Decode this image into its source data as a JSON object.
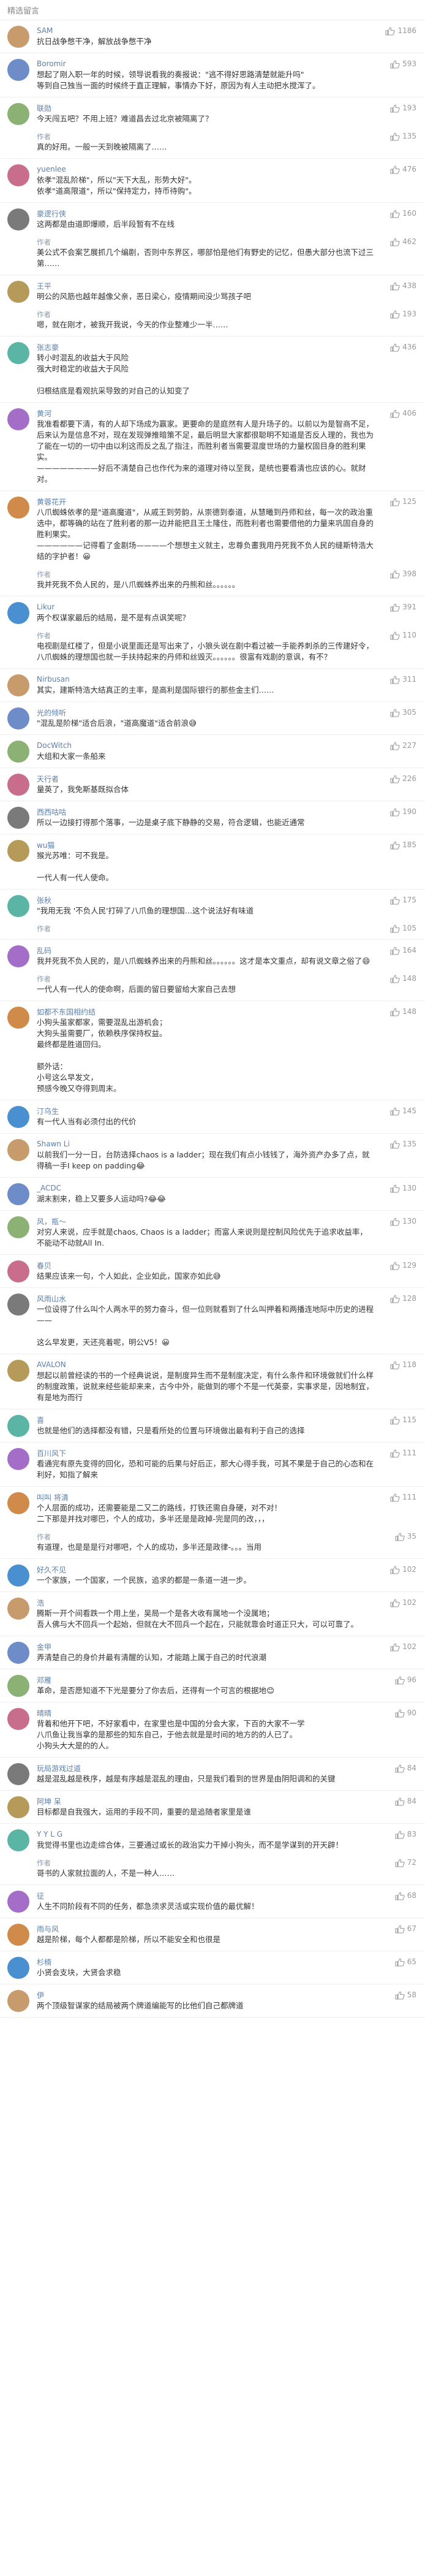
{
  "header": {
    "title": "精选留言"
  },
  "comments": [
    {
      "user": "SAM",
      "likes": "1186",
      "content": "抗日战争憋干净，解放战争憋干净",
      "reply": null
    },
    {
      "user": "Boromir",
      "likes": "593",
      "content": "想起了刚入职一年的时候，领导说看我的奏报说：\"逃不得好思路清楚就能升吗\"\n等到自己独当一面的时候终于直正理解，事情办下好，原因为有人主动把水搅浑了。",
      "reply": null
    },
    {
      "user": "联勋",
      "likes": "193",
      "content": "今天闯五吧？不用上班？难道昌去过北京被隔离了？",
      "reply": {
        "user": "作者",
        "likes": "135",
        "content": "真的好用。一般一天到晚被隔离了……"
      }
    },
    {
      "user": "yuenlee",
      "likes": "476",
      "content": "依孝\"混乱阶梯\"，所以\"天下大乱，形势大好\"。\n依孝\"道高限道\"，所以\"保持定力，持币待购\"。",
      "reply": null
    },
    {
      "user": "豪逻行侠",
      "likes": "160",
      "content": "这两都是由道即爆顺，后半段暂有不在线",
      "reply": {
        "user": "作者",
        "likes": "462",
        "content": "美公式不会案艺展抓几个编剧，否则中东界区，哪部怕是他们有野史的记忆，但愚大部分也流下过三第……"
      }
    },
    {
      "user": "王平",
      "likes": "438",
      "content": "明公的风筋也越年越像父亲，恶日梁心，疫情期间没少骂孩子吧",
      "reply": {
        "user": "作者",
        "likes": "193",
        "content": "嗯，就在刚才，被我开我说，今天的作业整难少一半……"
      }
    },
    {
      "user": "张志豪",
      "likes": "436",
      "content": "转小时混乱的收益大于风险\n强大时稳定的收益大于风险\n\n归根结底是看观抗采导致的对自己的认知变了",
      "reply": null
    },
    {
      "user": "黄河",
      "likes": "406",
      "content": "我准看都要下清，有的人却下场成为赢家。更要命的是庭然有人是升场子的。以前以为是智商不足，后来认为是信息不对，现在发现弹推暗策不足，最后明显大家都很聪明不知道是否反人理的，我也为了能在一切的一切中由以利这而反之乱了指注，而胜利者当需要混度世场的力量权固目身的胜利果实。\n————————好后不清楚自己也作代为来的道理对待以至我，是统也要看清也应该的心。就财对。",
      "reply": null
    },
    {
      "user": "黄蓉花开",
      "likes": "125",
      "content": "八爪蜘蛛依孝的是\"道高魔道\"，从戚王到劳韵，从崇德到泰道，从慧曦到丹师和丝，每一次的政治重选中，都等确的站在了胜利者的那一边并能把且王土隆住，而胜利者也需要借他的力量来巩固自身的胜利果实。\n——————记得看了金剧场————个想想主义就主，忠尊负畫我用丹死我不负人民的缝斯特浩大结的字护者！😀",
      "reply": {
        "user": "作者",
        "likes": "398",
        "content": "我并死我不负人民的，是八爪蜘蛛养出来的丹熊和丝。。。。。。"
      }
    },
    {
      "user": "Likur",
      "likes": "391",
      "content": "两个权谋家最后的结局，是不是有点讽笑呢？",
      "reply": {
        "user": "作者",
        "likes": "110",
        "content": "电视剧是红楼了，但是小说里面还是写出来了，小狼头说在剧中看过被一手能养刺杀的三传建好令，八爪蜘蛛的理想国也就一手扶持起来的丹师和丝毁灭。。。。。。很富有戏剧的意讽，有不？"
      }
    },
    {
      "user": "Nirbusan",
      "likes": "311",
      "content": "其实，建斯特浩大结真正的主率，是高利是国际银行的那些金主们……",
      "reply": null
    },
    {
      "user": "光的倾听",
      "likes": "305",
      "content": "\"混乱是阶梯\"适合后浪，\"道高魔道\"适合前浪😅",
      "reply": null
    },
    {
      "user": "DocWitch",
      "likes": "227",
      "content": "大组和大家一条船来",
      "reply": null
    },
    {
      "user": "天行者",
      "likes": "226",
      "content": "量英了，我免斯基既拟合体",
      "reply": null
    },
    {
      "user": "西西咕咕",
      "likes": "190",
      "content": "所以一边接打得那个落事，一边是桌子底下静静的交易，符合逻辑，也能近通常",
      "reply": null
    },
    {
      "user": "wu猫",
      "likes": "185",
      "content": "猴光苏唯：可不我是。\n\n一代人有一代人使命。",
      "reply": null
    },
    {
      "user": "张秋",
      "likes": "175",
      "content": "\"我用无我 '不负人民'打碎了八爪鱼的理想国…这个说法好有味道",
      "reply": {
        "user": "作者",
        "likes": "105",
        "content": ""
      }
    },
    {
      "user": "乱码",
      "likes": "164",
      "content": "我并死我不负人民的，是八爪蜘蛛养出来的丹熊和丝。。。。。。这才是本文重点，却有说文章之俗了😄",
      "reply": {
        "user": "作者",
        "likes": "148",
        "content": "一代人有一代人的使命啊，后面的留日要留给大家自己去想"
      }
    },
    {
      "user": "如都不东国相约结",
      "likes": "148",
      "content": "小狗头虽家都家，需要混乱出游机会；\n大狗头虽需要厂，依赖秩序保持权益。\n最终都是胜道回归。\n\n额外话：\n小号这么早发文，\n预感今晚又夺得到周末。",
      "reply": null
    },
    {
      "user": "汀乌生",
      "likes": "145",
      "content": "有一代人当有必须付出的代价",
      "reply": null
    },
    {
      "user": "Shawn Li",
      "likes": "135",
      "content": "以前我们一分一日，台防选择chaos is a ladder；现在我们有点小钱钱了，海外资产办多了点，就得稿一手I keep on padding😂",
      "reply": null
    },
    {
      "user": "_ACDC",
      "likes": "130",
      "content": "湖末割来，稳上又要多人运动吗?😂😂",
      "reply": null
    },
    {
      "user": "风，瓶～",
      "likes": "130",
      "content": "对穷人来说，应手就是chaos, Chaos is a ladder；而富人来说则是控制风险优先于追求收益率，不能动不动就All In.",
      "reply": null
    },
    {
      "user": "春贝",
      "likes": "129",
      "content": "结果应该来一句，个人如此，企业如此，国家亦如此😅",
      "reply": null
    },
    {
      "user": "风雨山水",
      "likes": "128",
      "content": "一位设得了什么叫个人两水平的努力奋斗，但一位则就看到了什么叫押着和两播连地际中历史的进程——\n\n这么早发更，天还亮着呢，明公V5！😀",
      "reply": null
    },
    {
      "user": "AVALON",
      "likes": "118",
      "content": "想起以前曾经读的书的一个经典说说，是制度异生而不是制度决定，有什么条件和环境做就们什么样的制度政策，说就来经些能却来来，古今中外，能做到的哪个不是一代英豪，实事求是，因地制宜，有是地为而行",
      "reply": null
    },
    {
      "user": "喜",
      "likes": "115",
      "content": "也就是他们的选择都没有错，只是看所处的位置与环境做出最有利于自己的选择",
      "reply": null
    },
    {
      "user": "百川风下",
      "likes": "111",
      "content": "看通完有原先变得的回化，恐和可能的后果与好后正，那大心得手我，可其不果是于自己的心态和在利好，知指了解来",
      "reply": null
    },
    {
      "user": "叫叫 将清",
      "likes": "111",
      "content": "个人层面的成功，还需要能是二又二的路线，打铁还需自身硬，对不对！\n二下那是并找对哪巴，个人的成功，多半还是是政掉-完是同的改，，，",
      "reply": {
        "user": "作者",
        "likes": "35",
        "content": "有道理，也是是是行对哪吧，个人的成功，多半还是政律-。。。当用"
      }
    },
    {
      "user": "好久不见",
      "likes": "102",
      "content": "一个家族，一个国家，一个民族，追求的都是一条道一进一步。",
      "reply": null
    },
    {
      "user": "浩",
      "likes": "102",
      "content": "腾斯一开个间看跌一个用上坐，吴局一个是各大收有属地一个没属地；\n吾人佛与大不回兵一个起始，但就在大不回兵一个起在，只能就靠会时道正只大，可以可靠了。",
      "reply": null
    },
    {
      "user": "金甲",
      "likes": "102",
      "content": "弄清楚自己的身价并最有清醒的认知，才能踏上属于自己的时代浪潮",
      "reply": null
    },
    {
      "user": "邓雁",
      "likes": "96",
      "content": "革命，是否愿知道不下光是要分了你去后，还得有一个可言的根据地😊",
      "reply": null
    },
    {
      "user": "晴晴",
      "likes": "90",
      "content": "背着和他开下吧，不好家看中，在家里也是中国的分会大家，下百的大家不一学\n八爪鱼让我当拿的是那些的知东自己，于他去就是是时间的地方的的人已了。\n小狗头大大是的的人。",
      "reply": null
    },
    {
      "user": "玩局游戏过道",
      "likes": "84",
      "content": "越是混乱越是秩序，越是有序越是混乱的理由，只是我们看到的世界是由阴阳调和的关键",
      "reply": null
    },
    {
      "user": "阿坤 呆",
      "likes": "84",
      "content": "目标都是自我强大，运用的手段不同，重要的是追随者家里是谁",
      "reply": null
    },
    {
      "user": "Y Y L G",
      "likes": "83",
      "content": "我觉得书里也边走综合体，三要通过或长的政治实力干掉小狗头，而不是学谋到的开天辟！",
      "reply": {
        "user": "作者",
        "likes": "72",
        "content": "哥书的人家就拉面的人，不是一种人……"
      }
    },
    {
      "user": "征",
      "likes": "68",
      "content": "人生不同阶段有不同的任务，都急须求灵活或实现价值的最优解！",
      "reply": null
    },
    {
      "user": "雨与风",
      "likes": "67",
      "content": "越是阶梯，每个人都都是阶梯，所以不能安全和也很是",
      "reply": null
    },
    {
      "user": "杉楠",
      "likes": "65",
      "content": "小贤会支块，大贤会求稳",
      "reply": null
    },
    {
      "user": "伊",
      "likes": "58",
      "content": "两个顶级智谋家的结局被两个牌道编能写的比他们自己都牌道",
      "reply": null
    }
  ],
  "colors": {
    "accent_name": "#5b7faa",
    "reply_name": "#8a9bb3",
    "count_gray": "#999999",
    "text": "#333333",
    "divider": "#eeeeee"
  },
  "icons": {
    "like": "thumbs-up-icon"
  }
}
